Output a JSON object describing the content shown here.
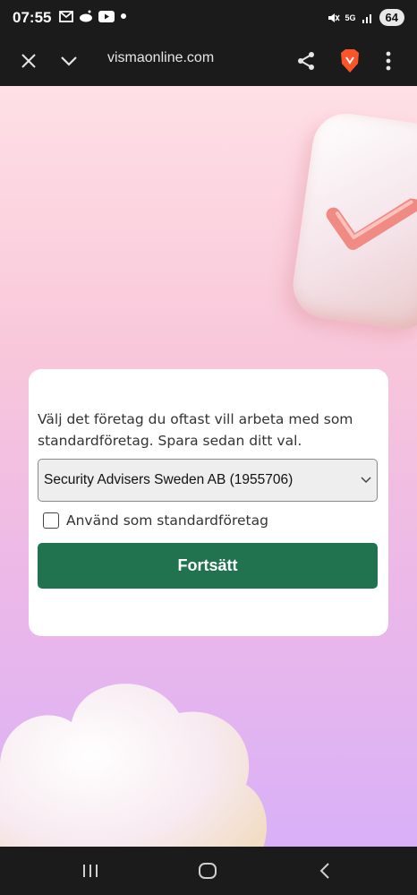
{
  "status_bar": {
    "time": "07:55",
    "network": "5G",
    "battery": "64",
    "icons_left": [
      "gmail-icon",
      "reddit-icon",
      "youtube-icon",
      "dot-icon"
    ],
    "icons_right": [
      "mute-icon",
      "network-icon",
      "signal-icon",
      "battery-icon"
    ]
  },
  "toolbar": {
    "url_prefix": "",
    "url": "vismaonline.com",
    "icons": [
      "close-icon",
      "chevron-down-icon",
      "share-icon",
      "brave-icon",
      "more-icon"
    ]
  },
  "card": {
    "description": "Välj det företag du oftast vill arbeta med som standardföretag. Spara sedan ditt val.",
    "select_value": "Security Advisers Sweden AB (1955706)",
    "checkbox_label": "Använd som standardföretag",
    "checkbox_checked": false,
    "button_label": "Fortsätt"
  },
  "colors": {
    "primary_button": "#217350",
    "background_top": "#ffe0e6",
    "background_bottom": "#d9b0f7"
  },
  "nav_bar": {
    "icons": [
      "recent-apps-icon",
      "home-icon",
      "back-icon"
    ]
  }
}
